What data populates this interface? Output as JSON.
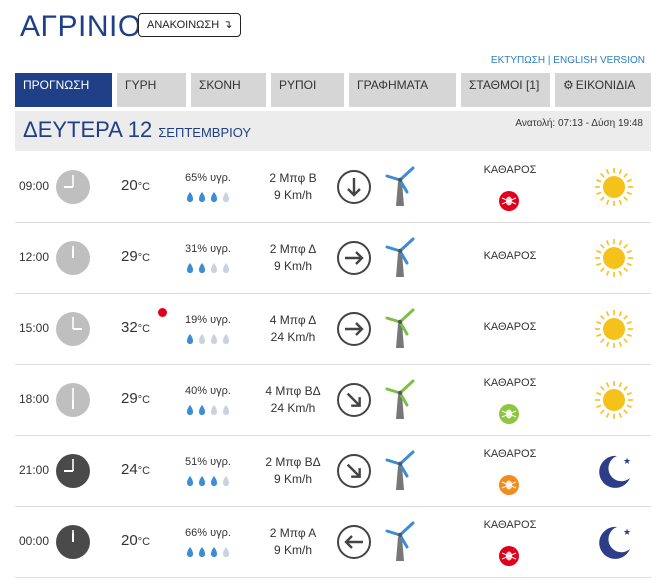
{
  "header": {
    "city": "ΑΓΡΙΝΙΟ",
    "announce_label": "ΑΝΑΚΟΙΝΩΣΗ",
    "announce_arrow": "↴",
    "print_link": "ΕΚΤΥΠΩΣΗ",
    "separator": "|",
    "english_link": "ENGLISH VERSION"
  },
  "tabs": [
    {
      "label": "ΠΡΟΓΝΩΣΗ",
      "active": true
    },
    {
      "label": "ΓΥΡΗ"
    },
    {
      "label": "ΣΚΟΝΗ"
    },
    {
      "label": "ΡΥΠΟΙ"
    },
    {
      "label": "ΓΡΑΦΗΜΑΤΑ"
    },
    {
      "label": "ΣΤΑΘΜΟΙ [1]"
    },
    {
      "label": "ΕΙΚΟΝΙΔΙΑ",
      "icon": "gear-icon"
    }
  ],
  "day": {
    "name": "ΔΕΥΤΕΡΑ 12",
    "month": "ΣΕΠΤΕΜΒΡΙΟΥ",
    "sun": "Ανατολή: 07:13  - Δύση 19:48"
  },
  "colors": {
    "brand": "#1f3f87",
    "tab_bg": "#d6d6d6",
    "clock_day": "#bfbfbf",
    "clock_night": "#4a4a4a",
    "drop_full": "#3c8dd6",
    "drop_empty": "#c8d3df",
    "wind_blade_blue": "#3c8dd6",
    "wind_blade_green": "#7ac143",
    "sun": "#f4c21a",
    "moon": "#2c3e8a",
    "dust_red": "#e0001b",
    "dust_green": "#8dc63f",
    "dust_orange": "#f28c1e"
  },
  "temp_unit": "°C",
  "rows": [
    {
      "time": "09:00",
      "clock": "day",
      "temp": "20",
      "hot": false,
      "humidity": "65% υγρ.",
      "drops": 3,
      "wind_bf": "2 Μπφ Β",
      "wind_kmh": "9 Km/h",
      "wind_dir": "down",
      "blade": "blue",
      "dust": "ΚΑΘΑΡΟΣ",
      "dust_badge": "red",
      "weather": "sun-icon"
    },
    {
      "time": "12:00",
      "clock": "day",
      "temp": "29",
      "hot": false,
      "humidity": "31% υγρ.",
      "drops": 2,
      "wind_bf": "2 Μπφ Δ",
      "wind_kmh": "9 Km/h",
      "wind_dir": "right",
      "blade": "blue",
      "dust": "ΚΑΘΑΡΟΣ",
      "dust_badge": "",
      "weather": "sun-icon"
    },
    {
      "time": "15:00",
      "clock": "day",
      "temp": "32",
      "hot": true,
      "humidity": "19% υγρ.",
      "drops": 1,
      "wind_bf": "4 Μπφ Δ",
      "wind_kmh": "24 Km/h",
      "wind_dir": "right",
      "blade": "green",
      "dust": "ΚΑΘΑΡΟΣ",
      "dust_badge": "",
      "weather": "sun-icon"
    },
    {
      "time": "18:00",
      "clock": "day",
      "temp": "29",
      "hot": false,
      "humidity": "40% υγρ.",
      "drops": 2,
      "wind_bf": "4 Μπφ ΒΔ",
      "wind_kmh": "24 Km/h",
      "wind_dir": "down-right",
      "blade": "green",
      "dust": "ΚΑΘΑΡΟΣ",
      "dust_badge": "green",
      "weather": "sun-icon"
    },
    {
      "time": "21:00",
      "clock": "night",
      "temp": "24",
      "hot": false,
      "humidity": "51% υγρ.",
      "drops": 3,
      "wind_bf": "2 Μπφ ΒΔ",
      "wind_kmh": "9 Km/h",
      "wind_dir": "down-right",
      "blade": "blue",
      "dust": "ΚΑΘΑΡΟΣ",
      "dust_badge": "orange",
      "weather": "moon-icon"
    },
    {
      "time": "00:00",
      "clock": "night",
      "temp": "20",
      "hot": false,
      "humidity": "66% υγρ.",
      "drops": 3,
      "wind_bf": "2 Μπφ Α",
      "wind_kmh": "9 Km/h",
      "wind_dir": "left",
      "blade": "blue",
      "dust": "ΚΑΘΑΡΟΣ",
      "dust_badge": "red",
      "weather": "moon-icon"
    }
  ]
}
